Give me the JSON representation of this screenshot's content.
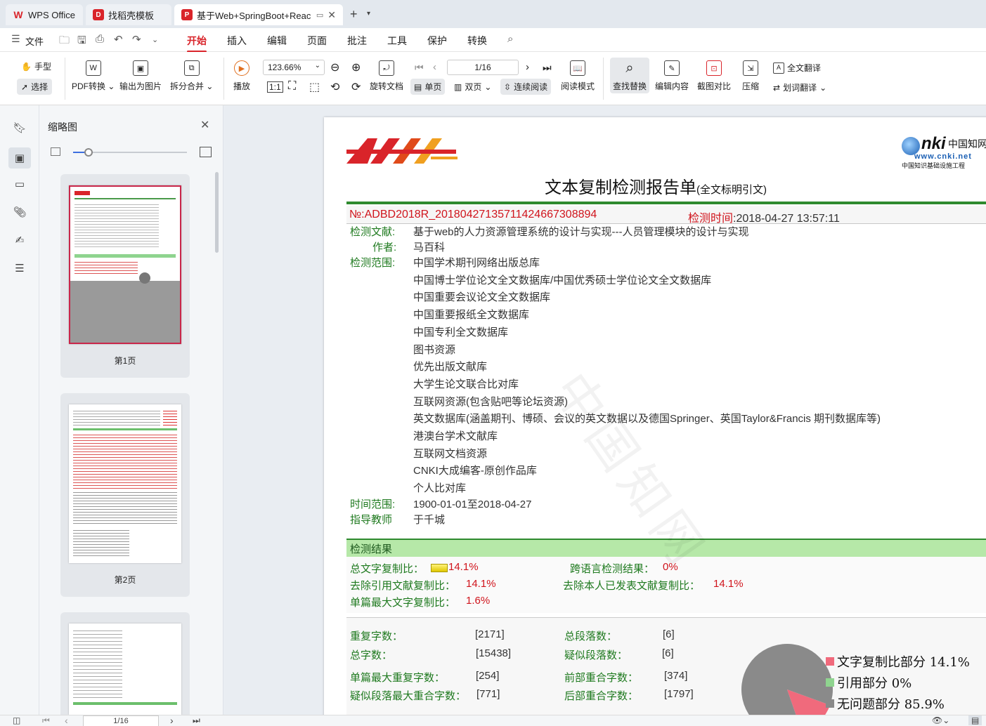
{
  "tabs": [
    {
      "label": "WPS Office",
      "icon": "wps-logo-icon",
      "color": "#d9242a"
    },
    {
      "label": "找稻壳模板",
      "icon": "docer-icon",
      "color": "#d9242a"
    },
    {
      "label": "基于Web+SpringBoot+Reac",
      "icon": "pdf-icon",
      "color": "#d9242a"
    }
  ],
  "menu": {
    "file": "文件",
    "items": [
      "开始",
      "插入",
      "编辑",
      "页面",
      "批注",
      "工具",
      "保护",
      "转换"
    ]
  },
  "ribbon": {
    "hand": "手型",
    "select": "选择",
    "pdf_convert": "PDF转换",
    "export_image": "输出为图片",
    "split_merge": "拆分合并",
    "play": "播放",
    "zoom": "123.66%",
    "page_input": "1/16",
    "rotate": "旋转文档",
    "single": "单页",
    "double": "双页",
    "continuous": "连续阅读",
    "read_mode": "阅读模式",
    "find_replace": "查找替换",
    "edit_content": "编辑内容",
    "crop_compare": "截图对比",
    "compress": "压缩",
    "full_translate": "全文翻译",
    "word_translate": "划词翻译"
  },
  "thumbnails": {
    "title": "缩略图",
    "pages": [
      "第1页",
      "第2页"
    ]
  },
  "document": {
    "title": "文本复制检测报告单",
    "title_suffix": "(全文标明引文)",
    "cnki_url": "www.cnki.net",
    "cnki_sub": "中国知识基础设施工程",
    "report_no_label": "№:",
    "report_no": "ADBD2018R_20180427135711424667308894",
    "check_time_label": "检测时间",
    "check_time": ":2018-04-27 13:57:11",
    "doc_label": "检测文献:",
    "doc_title": "基于web的人力资源管理系统的设计与实现---人员管理模块的设计与实现",
    "author_label": "作者:",
    "author": "马百科",
    "scope_label": "检测范围:",
    "scope": [
      "中国学术期刊网络出版总库",
      "中国博士学位论文全文数据库/中国优秀硕士学位论文全文数据库",
      "中国重要会议论文全文数据库",
      "中国重要报纸全文数据库",
      "中国专利全文数据库",
      "图书资源",
      "优先出版文献库",
      "大学生论文联合比对库",
      "互联网资源(包含贴吧等论坛资源)",
      "英文数据库(涵盖期刊、博硕、会议的英文数据以及德国Springer、英国Taylor&Francis 期刊数据库等)",
      "港澳台学术文献库",
      "互联网文档资源",
      "CNKI大成编客-原创作品库",
      "个人比对库"
    ],
    "time_range_label": "时间范围:",
    "time_range": "1900-01-01至2018-04-27",
    "advisor_label": "指导教师",
    "advisor": "于千城",
    "result_header": "检测结果",
    "total_copy_label": "总文字复制比：",
    "total_copy": "14.1%",
    "cross_lang_label": "跨语言检测结果：",
    "cross_lang": "0%",
    "excl_ref_label": "去除引用文献复制比：",
    "excl_ref": "14.1%",
    "excl_self_label": "去除本人已发表文献复制比：",
    "excl_self": "14.1%",
    "max_single_label": "单篇最大文字复制比：",
    "max_single": "1.6%",
    "repeat_chars_label": "重复字数：",
    "repeat_chars": "[2171]",
    "total_paras_label": "总段落数：",
    "total_paras": "[6]",
    "total_chars_label": "总字数：",
    "total_chars": "[15438]",
    "suspect_paras_label": "疑似段落数：",
    "suspect_paras": "[6]",
    "max_repeat_label": "单篇最大重复字数：",
    "max_repeat": "[254]",
    "front_overlap_label": "前部重合字数：",
    "front_overlap": "[374]",
    "suspect_max_label": "疑似段落最大重合字数：",
    "suspect_max": "[771]",
    "back_overlap_label": "后部重合字数：",
    "back_overlap": "[1797]",
    "legend": [
      {
        "label": "文字复制比部分 14.1%",
        "color": "#f06a7c"
      },
      {
        "label": "引用部分 0%",
        "color": "#8fd48f"
      },
      {
        "label": "无问题部分 85.9%",
        "color": "#8a8a8a"
      }
    ],
    "pie_values": [
      14.1,
      0,
      85.9
    ],
    "watermark": "中国知网"
  },
  "status": {
    "page_input": "1/16"
  }
}
